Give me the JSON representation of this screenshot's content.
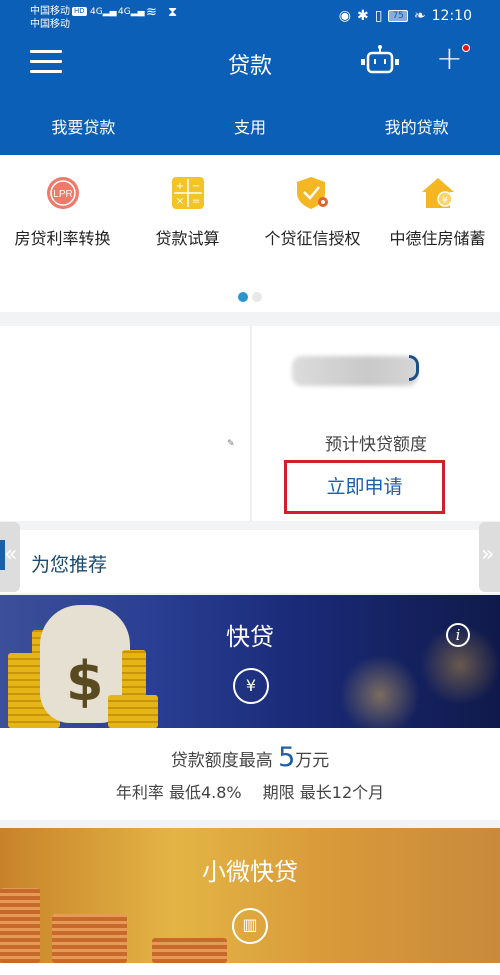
{
  "status_bar": {
    "carrier1": "中国移动",
    "carrier1_badge": "HD",
    "carrier2": "中国移动",
    "signal1": "4G",
    "signal2": "4G",
    "battery": "75",
    "time": "12:10",
    "icons": [
      "wifi-icon",
      "hourglass-icon",
      "eye-icon",
      "bluetooth-icon",
      "vibrate-icon",
      "battery-icon",
      "leaf-icon"
    ]
  },
  "header": {
    "title": "贷款",
    "menu_icon": "menu-icon",
    "robot_icon": "robot-icon",
    "plus_icon": "+",
    "notification_dot_color": "#e01818"
  },
  "tabs": [
    {
      "label": "我要贷款"
    },
    {
      "label": "支用"
    },
    {
      "label": "我的贷款"
    }
  ],
  "quick_actions": [
    {
      "label": "房贷利率转换",
      "icon": "lpr-icon",
      "icon_text": "LPR"
    },
    {
      "label": "贷款试算",
      "icon": "calculator-icon"
    },
    {
      "label": "个贷征信授权",
      "icon": "shield-check-icon"
    },
    {
      "label": "中德住房储蓄",
      "icon": "house-icon"
    }
  ],
  "carousel": {
    "pages": 2,
    "active": 1
  },
  "loan_card": {
    "estimate_label": "预计快贷额度",
    "apply_button": "立即申请"
  },
  "recommend": {
    "title": "为您推荐",
    "prev": "«",
    "next": "»"
  },
  "products": [
    {
      "title": "快贷",
      "icon_text": "¥",
      "info_icon": "i",
      "limit_prefix": "贷款额度最高",
      "limit_value": "5",
      "limit_unit": "万元",
      "details": "年利率 最低4.8%　 期限 最长12个月"
    },
    {
      "title": "小微快贷",
      "icon_text": "▥"
    }
  ],
  "colors": {
    "primary": "#0b5fb6",
    "apply_border": "#d0202c",
    "accent_text": "#1b5fa8"
  }
}
